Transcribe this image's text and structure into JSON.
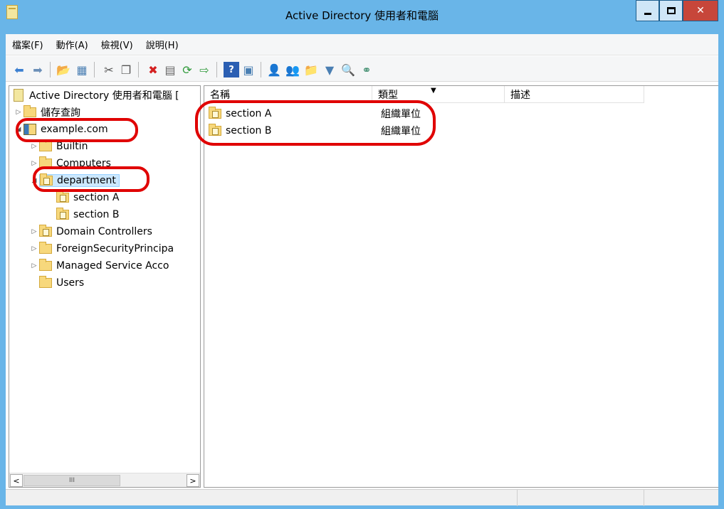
{
  "window": {
    "title": "Active Directory 使用者和電腦"
  },
  "menu": [
    "檔案(F)",
    "動作(A)",
    "檢視(V)",
    "說明(H)"
  ],
  "tree": {
    "root": "Active Directory 使用者和電腦 [",
    "saved_queries": "儲存查詢",
    "domain": "example.com",
    "builtin": "Builtin",
    "computers": "Computers",
    "department": "department",
    "section_a": "section A",
    "section_b": "section B",
    "domain_controllers": "Domain Controllers",
    "foreign": "ForeignSecurityPrincipa",
    "managed": "Managed Service Acco",
    "users": "Users"
  },
  "list": {
    "columns": {
      "name": "名稱",
      "type": "類型",
      "description": "描述"
    },
    "rows": [
      {
        "name": "section A",
        "type": "組織單位"
      },
      {
        "name": "section B",
        "type": "組織單位"
      }
    ]
  },
  "scrollbar": {
    "left": "<",
    "thumb": "III",
    "right": ">"
  },
  "colors": {
    "titlebar": "#69b5e8",
    "close": "#c7463a",
    "highlight": "#e00000",
    "selection": "#cce8ff"
  }
}
